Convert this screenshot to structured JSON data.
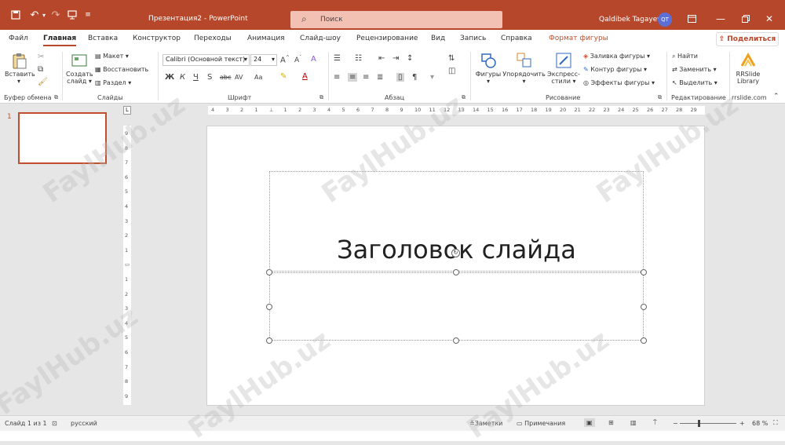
{
  "titlebar": {
    "document_title": "Презентация2 - PowerPoint",
    "search_placeholder": "Поиск",
    "user_name": "Qaldibek Tagayev",
    "user_initials": "QT"
  },
  "tabs": [
    "Файл",
    "Главная",
    "Вставка",
    "Конструктор",
    "Переходы",
    "Анимация",
    "Слайд-шоу",
    "Рецензирование",
    "Вид",
    "Запись",
    "Справка",
    "Формат фигуры"
  ],
  "share_label": "Поделиться",
  "ribbon": {
    "clipboard": {
      "paste": "Вставить",
      "label": "Буфер обмена"
    },
    "slides": {
      "new_slide_1": "Создать",
      "new_slide_2": "слайд",
      "layout": "Макет",
      "reset": "Восстановить",
      "section": "Раздел",
      "label": "Слайды"
    },
    "font": {
      "family": "Calibri (Основной текст)",
      "size": "24",
      "label": "Шрифт",
      "bold": "Ж",
      "italic": "К",
      "underline": "Ч",
      "shadow": "S",
      "strike": "abc",
      "spacing": "AV",
      "case": "Aa"
    },
    "paragraph": {
      "label": "Абзац"
    },
    "drawing": {
      "shapes": "Фигуры",
      "arrange": "Упорядочить",
      "quick_1": "Экспресс-",
      "quick_2": "стили",
      "fill": "Заливка фигуры",
      "outline": "Контур фигуры",
      "effects": "Эффекты фигуры",
      "label": "Рисование"
    },
    "editing": {
      "find": "Найти",
      "replace": "Заменить",
      "select": "Выделить",
      "label": "Редактирование"
    },
    "rrslide": {
      "name_1": "RRSlide",
      "name_2": "Library",
      "label": "rrslide.com"
    }
  },
  "thumbnail": {
    "slide_number": "1"
  },
  "slide": {
    "title": "Заголовок слайда"
  },
  "ruler": {
    "h_ticks": [
      "4",
      "3",
      "2",
      "1",
      "",
      "1",
      "2",
      "3",
      "4",
      "5",
      "6",
      "7",
      "8",
      "9",
      "10",
      "11",
      "12",
      "13",
      "14",
      "15",
      "16",
      "17",
      "18",
      "19",
      "20",
      "21",
      "22",
      "23",
      "24",
      "25",
      "26",
      "27",
      "28",
      "29"
    ],
    "v_ticks": [
      "9",
      "8",
      "7",
      "6",
      "5",
      "4",
      "3",
      "2",
      "1",
      "",
      "1",
      "2",
      "3",
      "4",
      "5",
      "6",
      "7",
      "8",
      "9"
    ]
  },
  "status": {
    "slide_counter": "Слайд 1 из 1",
    "language": "русский",
    "notes": "Заметки",
    "comments": "Примечания",
    "zoom": "68 %"
  },
  "watermark": "FaylHub.uz",
  "colors": {
    "accent": "#b7472a",
    "selection_orange": "#c0502c"
  }
}
